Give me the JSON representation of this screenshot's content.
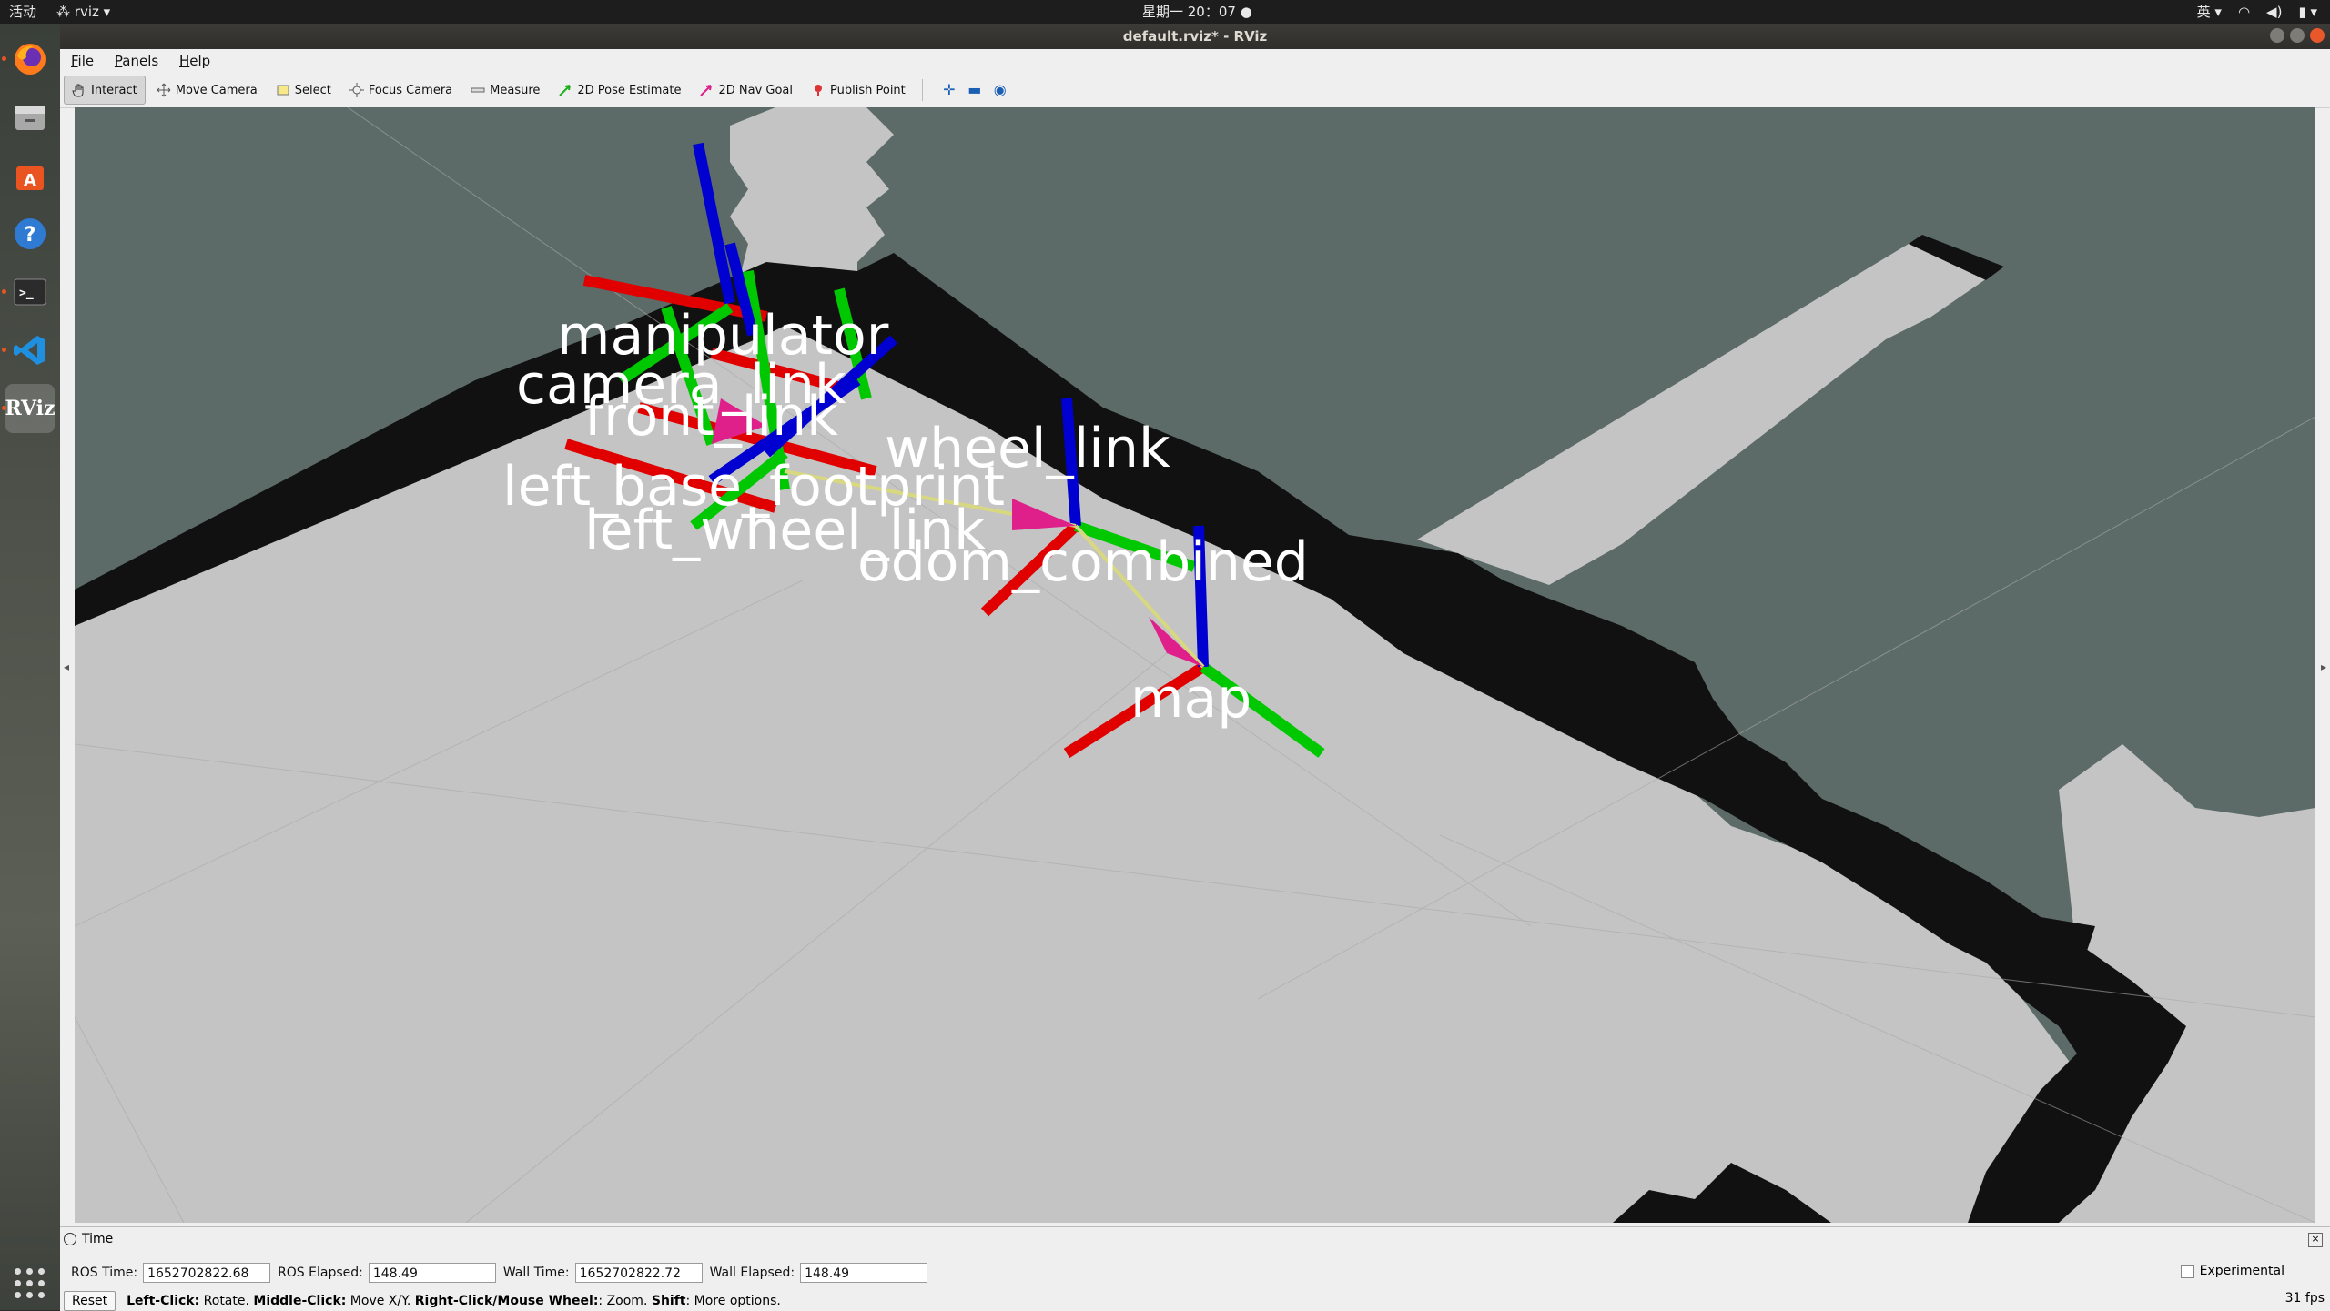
{
  "topbar": {
    "activities": "活动",
    "app_name": "rviz",
    "clock": "星期一 20：07",
    "input_method": "英"
  },
  "window": {
    "title": "default.rviz* - RViz"
  },
  "menu": [
    "File",
    "Panels",
    "Help"
  ],
  "toolbar": {
    "tools": [
      {
        "label": "Interact",
        "icon": "hand-icon",
        "active": true
      },
      {
        "label": "Move Camera",
        "icon": "move-camera-icon",
        "active": false
      },
      {
        "label": "Select",
        "icon": "select-icon",
        "active": false
      },
      {
        "label": "Focus Camera",
        "icon": "focus-camera-icon",
        "active": false
      },
      {
        "label": "Measure",
        "icon": "ruler-icon",
        "active": false
      },
      {
        "label": "2D Pose Estimate",
        "icon": "green-arrow-icon",
        "active": false
      },
      {
        "label": "2D Nav Goal",
        "icon": "pink-arrow-icon",
        "active": false
      },
      {
        "label": "Publish Point",
        "icon": "pin-icon",
        "active": false
      }
    ]
  },
  "viewport": {
    "frame_labels": [
      "manipulator",
      "camera_link",
      "front_link",
      "wheel_link",
      "left_",
      "base_footprint",
      "left_wheel_link",
      "odom_combined",
      "map"
    ],
    "colors": {
      "background": "#5c6b67",
      "free_space": "#c4c4c4",
      "occupied": "#111111",
      "x_axis": "#e00000",
      "y_axis": "#00c800",
      "z_axis": "#0000d0",
      "arrow": "#e0208a"
    }
  },
  "time_panel": {
    "title": "Time",
    "ros_time_label": "ROS Time:",
    "ros_time_value": "1652702822.68",
    "ros_elapsed_label": "ROS Elapsed:",
    "ros_elapsed_value": "148.49",
    "wall_time_label": "Wall Time:",
    "wall_time_value": "1652702822.72",
    "wall_elapsed_label": "Wall Elapsed:",
    "wall_elapsed_value": "148.49",
    "experimental_label": "Experimental"
  },
  "status": {
    "reset_label": "Reset",
    "hint_left_bold": "Left-Click:",
    "hint_left": " Rotate. ",
    "hint_middle_bold": "Middle-Click:",
    "hint_middle": " Move X/Y. ",
    "hint_right_bold": "Right-Click/Mouse Wheel:",
    "hint_right": ": Zoom. ",
    "hint_shift_bold": "Shift",
    "hint_shift": ": More options.",
    "fps": "31 fps"
  }
}
